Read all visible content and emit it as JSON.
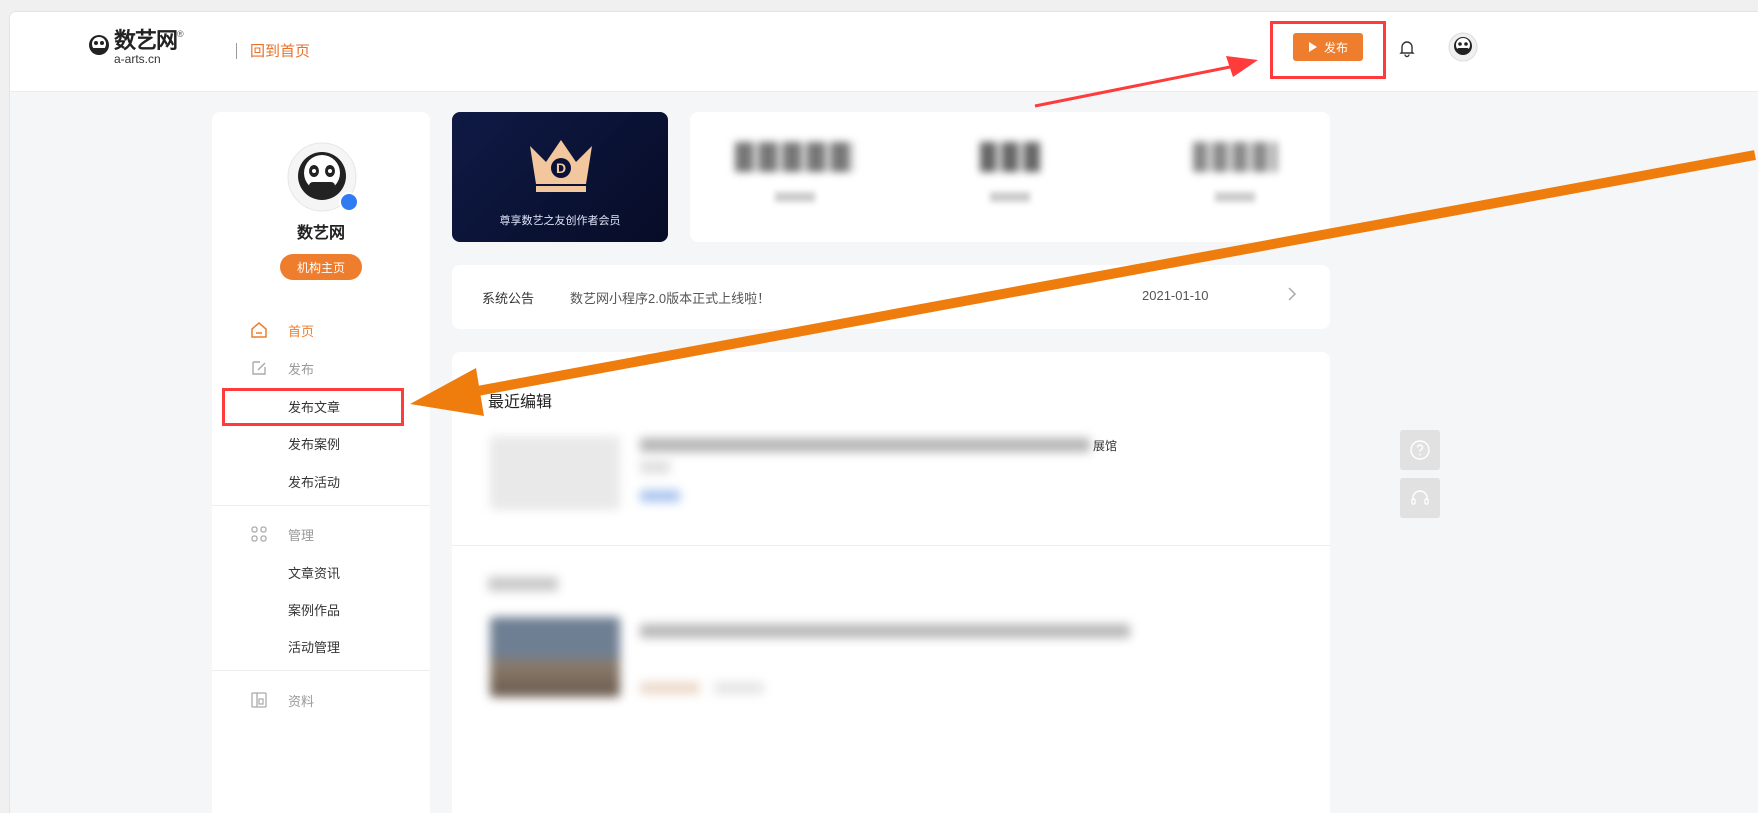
{
  "header": {
    "logo_cn": "数艺网",
    "logo_reg": "®",
    "logo_en": "a-arts.cn",
    "back_home": "回到首页",
    "publish_label": "发布"
  },
  "sidebar": {
    "name": "数艺网",
    "org_button": "机构主页",
    "home": "首页",
    "publish_group": "发布",
    "publish_items": [
      "发布文章",
      "发布案例",
      "发布活动"
    ],
    "manage_group": "管理",
    "manage_items": [
      "文章资讯",
      "案例作品",
      "活动管理"
    ],
    "profile_group": "资料"
  },
  "vip": {
    "text": "尊享数艺之友创作者会员"
  },
  "stats": [
    {
      "value": "",
      "label": ""
    },
    {
      "value": "",
      "label": ""
    },
    {
      "value": "",
      "label": ""
    }
  ],
  "notice": {
    "tag": "系统公告",
    "title": "数艺网小程序2.0版本正式上线啦！",
    "date": "2021-01-10"
  },
  "recent": {
    "title": "最近编辑",
    "item1_suffix": "展馆"
  },
  "colors": {
    "accent": "#ee7d2e",
    "annotation_red": "#ff3b3b",
    "annotation_orange": "#ee7d0e"
  }
}
